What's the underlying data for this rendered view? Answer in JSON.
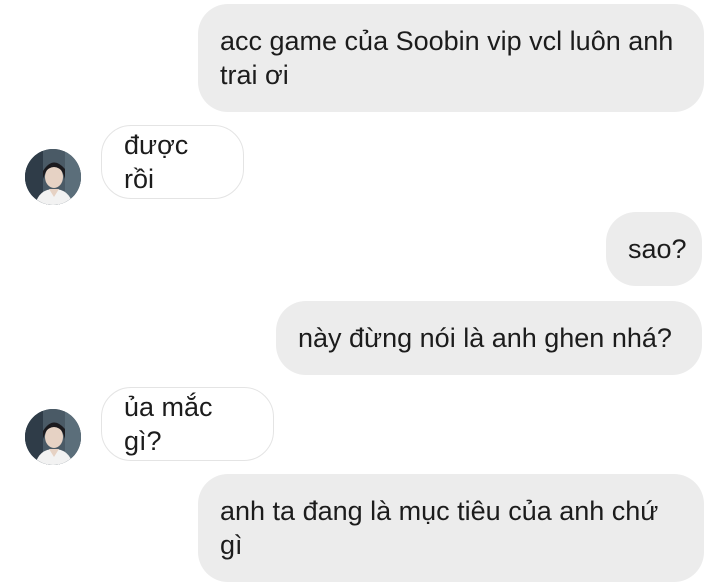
{
  "conversation": {
    "messages": [
      {
        "sender": "me",
        "text": "acc game của Soobin vip vcl luôn anh trai ơi"
      },
      {
        "sender": "contact",
        "text": "được rồi",
        "avatar": "contact-avatar"
      },
      {
        "sender": "me",
        "text": "sao?"
      },
      {
        "sender": "me",
        "text": "này đừng nói là anh ghen nhá?"
      },
      {
        "sender": "contact",
        "text": "ủa mắc gì?",
        "avatar": "contact-avatar"
      },
      {
        "sender": "me",
        "text": "anh ta đang là mục tiêu của anh chứ gì"
      }
    ]
  },
  "colors": {
    "sent_bubble": "#ececec",
    "received_bubble": "#ffffff",
    "received_border": "#e4e4e4",
    "text": "#1c1c1c"
  }
}
